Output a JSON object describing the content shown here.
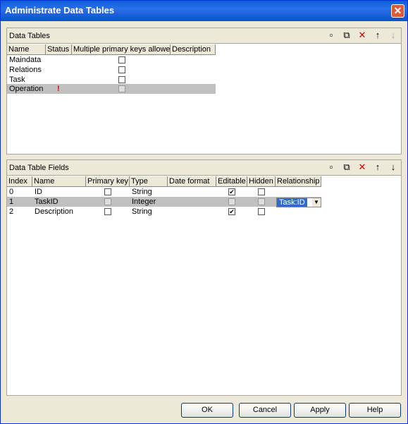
{
  "window": {
    "title": "Administrate Data Tables"
  },
  "tables": {
    "title": "Data Tables",
    "columns": [
      "Name",
      "Status",
      "Multiple primary keys allowed",
      "Description"
    ],
    "rows": [
      {
        "name": "Maindata",
        "status": ""
      },
      {
        "name": "Relations",
        "status": ""
      },
      {
        "name": "Task",
        "status": ""
      },
      {
        "name": "Operation",
        "status": "!"
      }
    ]
  },
  "fields": {
    "title": "Data Table Fields",
    "columns": [
      "Index",
      "Name",
      "Primary key",
      "Type",
      "Date format",
      "Editable",
      "Hidden",
      "Relationship"
    ],
    "rows": [
      {
        "index": "0",
        "name": "ID",
        "type": "String",
        "relationship": ""
      },
      {
        "index": "1",
        "name": "TaskID",
        "type": "Integer",
        "relationship": "Task:ID"
      },
      {
        "index": "2",
        "name": "Description",
        "type": "String",
        "relationship": ""
      }
    ]
  },
  "buttons": {
    "ok": "OK",
    "cancel": "Cancel",
    "apply": "Apply",
    "help": "Help"
  },
  "icons": {
    "new": "new-icon",
    "copy": "copy-icon",
    "delete": "delete-icon",
    "up": "arrow-up-icon",
    "down": "arrow-down-icon"
  }
}
